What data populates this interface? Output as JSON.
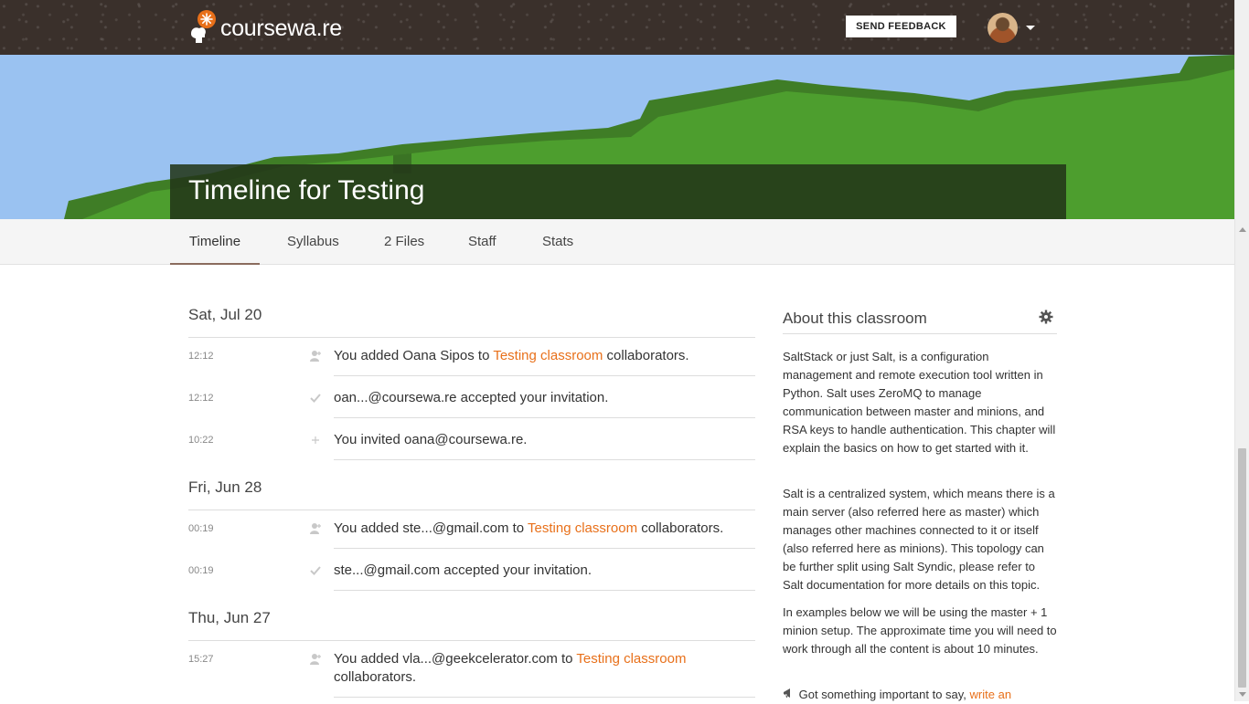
{
  "header": {
    "logo_text": "coursewa.re",
    "feedback_label": "SEND FEEDBACK",
    "avatar_icon": "user-avatar",
    "menu_icon": "caret-down-icon"
  },
  "page": {
    "title": "Timeline for Testing"
  },
  "tabs": [
    {
      "label": "Timeline",
      "active": true
    },
    {
      "label": "Syllabus"
    },
    {
      "label": "2 Files"
    },
    {
      "label": "Staff"
    },
    {
      "label": "Stats"
    }
  ],
  "timeline": {
    "groups": [
      {
        "date": "Sat, Jul 20",
        "entries": [
          {
            "time": "12:12",
            "icon": "add-user-icon",
            "before": "You added Oana Sipos to ",
            "link": "Testing classroom",
            "after": " collaborators."
          },
          {
            "time": "12:12",
            "icon": "checkmark-icon",
            "text": "oan...@coursewa.re accepted your invitation."
          },
          {
            "time": "10:22",
            "icon": "plus-icon",
            "text": "You invited oana@coursewa.re."
          }
        ]
      },
      {
        "date": "Fri, Jun 28",
        "entries": [
          {
            "time": "00:19",
            "icon": "add-user-icon",
            "before": "You added ste...@gmail.com to ",
            "link": "Testing classroom",
            "after": " collaborators."
          },
          {
            "time": "00:19",
            "icon": "checkmark-icon",
            "text": "ste...@gmail.com accepted your invitation."
          }
        ]
      },
      {
        "date": "Thu, Jun 27",
        "entries": [
          {
            "time": "15:27",
            "icon": "add-user-icon",
            "before": "You added vla...@geekcelerator.com to ",
            "link": "Testing classroom",
            "after": " collaborators."
          }
        ]
      }
    ]
  },
  "about": {
    "title": "About this classroom",
    "settings_icon": "gear-icon",
    "paragraphs": [
      "SaltStack or just Salt, is a configuration management and remote execution tool written in Python. Salt uses ZeroMQ to manage communication between master and minions, and RSA keys to handle authentication. This chapter will explain the basics on how to get started with it.",
      "Salt is a centralized system, which means there is a main server (also referred here as master) which manages other machines connected to it or itself (also referred here as minions). This topology can be further split using Salt Syndic, please refer to Salt documentation for more details on this topic.",
      "In examples below we will be using the master + 1 minion setup. The approximate time you will need to work through all the content is about 10 minutes."
    ],
    "footer_icon": "megaphone-icon",
    "footer_text": "Got something important to say, ",
    "footer_link": "write an"
  },
  "colors": {
    "topbar": "#3a302b",
    "sky": "#9ac2f1",
    "grass": "#4a9a2c",
    "accent_link": "#e8701a",
    "active_tab_underline": "#8a6c5e"
  }
}
